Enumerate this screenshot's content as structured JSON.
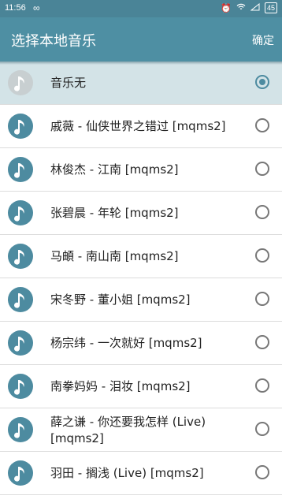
{
  "status_bar": {
    "time": "11:56",
    "battery": "45"
  },
  "app_bar": {
    "title": "选择本地音乐",
    "confirm_label": "确定"
  },
  "songs": [
    {
      "label": "音乐无",
      "selected": true
    },
    {
      "label": "戚薇 - 仙侠世界之错过 [mqms2]",
      "selected": false
    },
    {
      "label": "林俊杰 - 江南 [mqms2]",
      "selected": false
    },
    {
      "label": "张碧晨 - 年轮 [mqms2]",
      "selected": false
    },
    {
      "label": "马頔 - 南山南 [mqms2]",
      "selected": false
    },
    {
      "label": "宋冬野 - 董小姐 [mqms2]",
      "selected": false
    },
    {
      "label": "杨宗纬 - 一次就好 [mqms2]",
      "selected": false
    },
    {
      "label": "南拳妈妈 - 泪妆 [mqms2]",
      "selected": false
    },
    {
      "label": "薛之谦 - 你还要我怎样 (Live) [mqms2]",
      "selected": false
    },
    {
      "label": "羽田 - 搁浅 (Live) [mqms2]",
      "selected": false
    }
  ],
  "colors": {
    "accent": "#4e8fa3",
    "selected_row": "#d3e3e7"
  },
  "icons": {
    "song": "music-note-icon",
    "radio": "radio-button"
  }
}
